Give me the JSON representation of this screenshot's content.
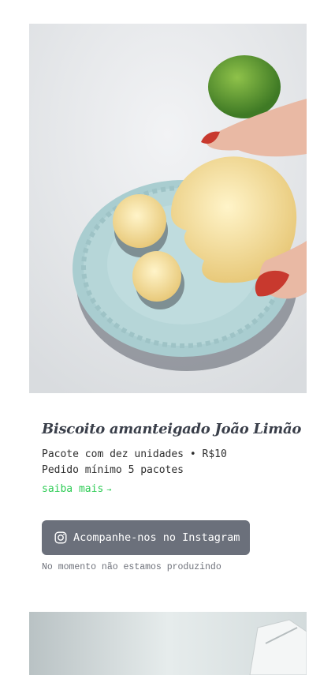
{
  "product": {
    "title": "Biscoito amanteigado João Limão",
    "package_line": "Pacote com dez unidades • R$10",
    "minimum_line": "Pedido mínimo 5 pacotes",
    "more_link": "saiba mais",
    "more_arrow": "→"
  },
  "instagram_button": {
    "label": "Acompanhe-nos no Instagram",
    "icon": "instagram-icon"
  },
  "status_text": "No momento não estamos produzindo",
  "colors": {
    "accent_link": "#2ecc55",
    "button_bg": "#6b707b",
    "title": "#3a3f4a"
  }
}
